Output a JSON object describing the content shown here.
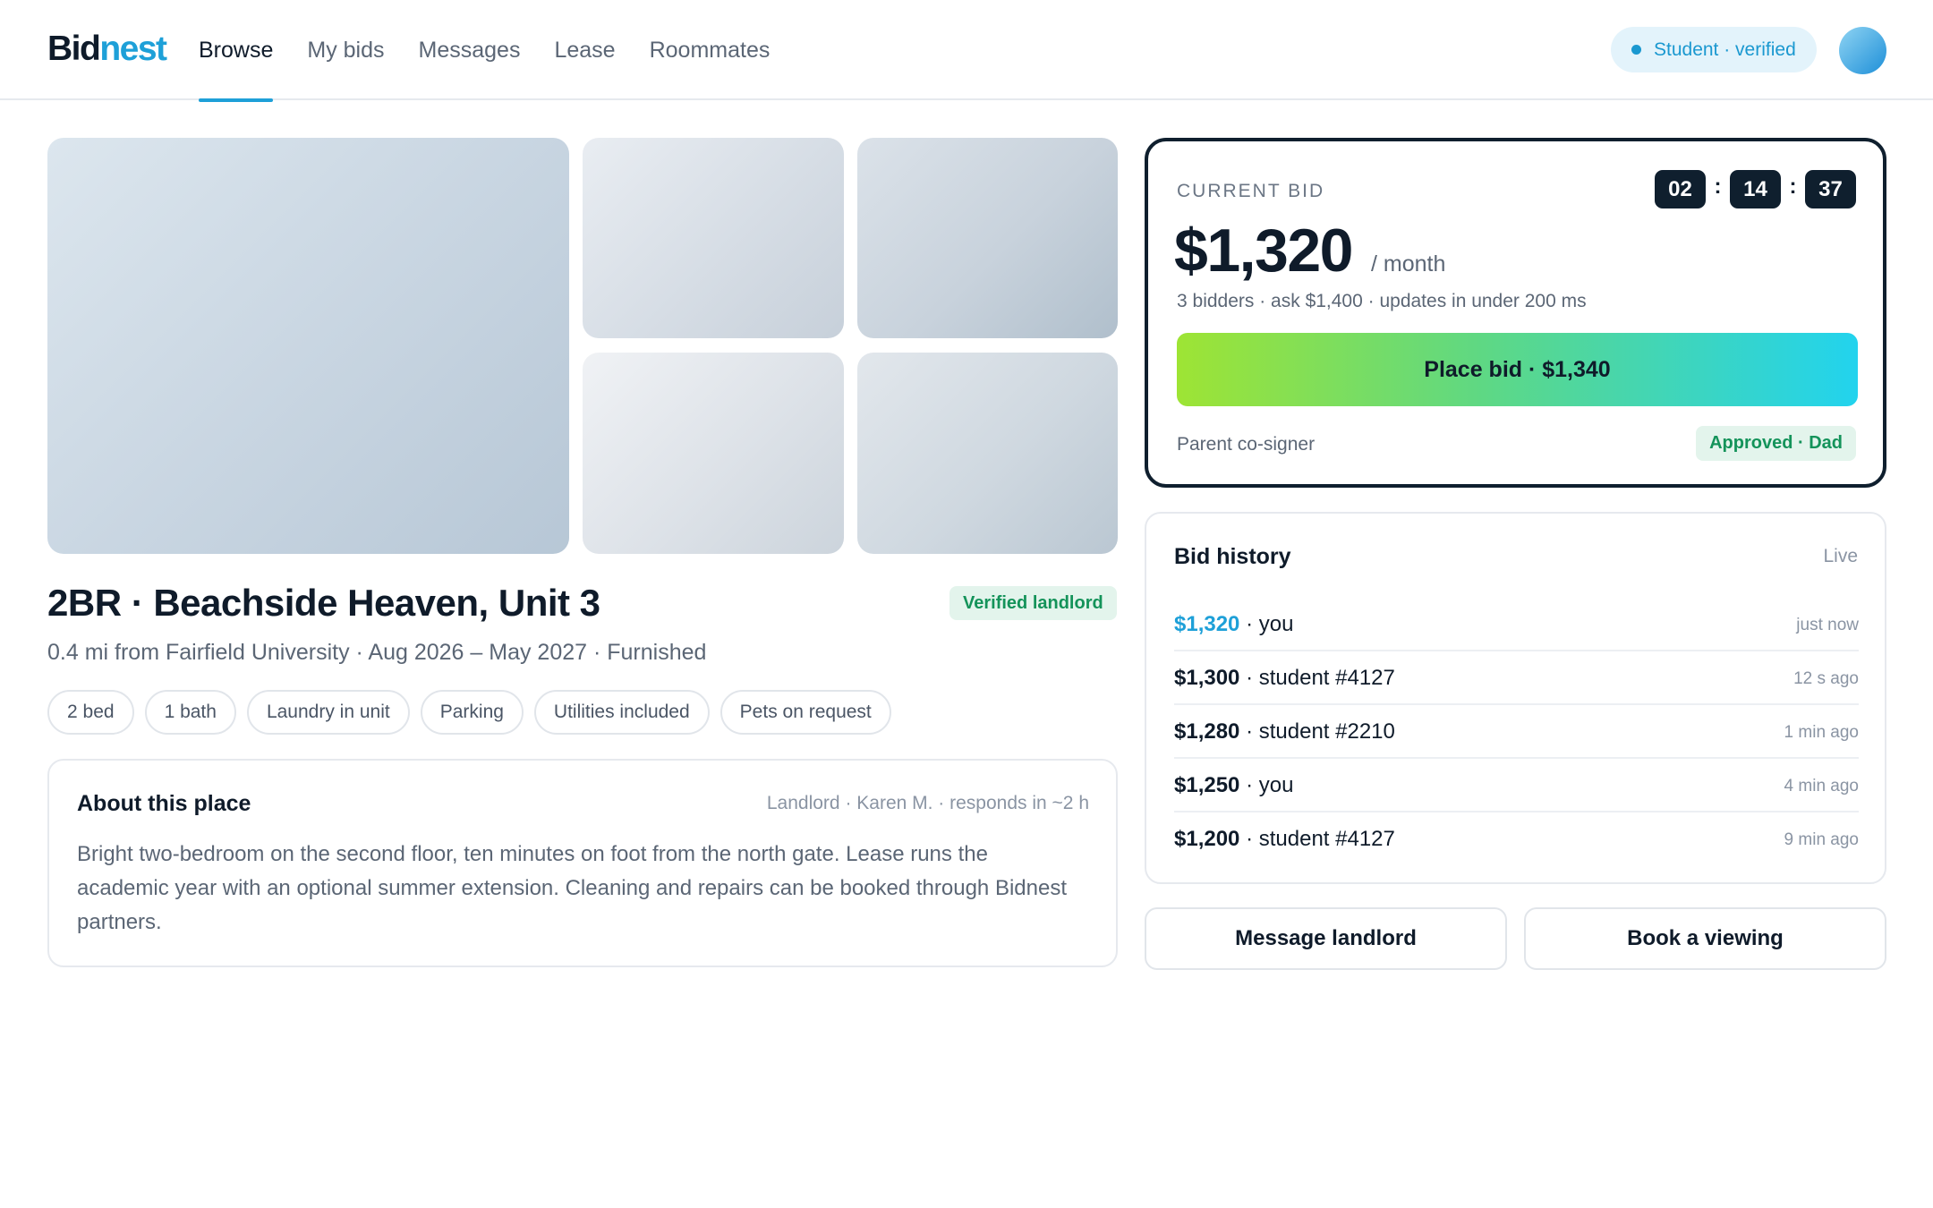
{
  "header": {
    "logo_part1": "Bid",
    "logo_part2": "nest",
    "nav": [
      {
        "label": "Browse",
        "active": true
      },
      {
        "label": "My bids"
      },
      {
        "label": "Messages"
      },
      {
        "label": "Lease"
      },
      {
        "label": "Roommates"
      }
    ],
    "status_pill": "Student · verified"
  },
  "listing": {
    "title": "2BR · Beachside Heaven, Unit 3",
    "badge": "Verified landlord",
    "subline": "0.4 mi from Fairfield University · Aug 2026 – May 2027 · Furnished",
    "chips": [
      "2 bed",
      "1 bath",
      "Laundry in unit",
      "Parking",
      "Utilities included",
      "Pets on request"
    ]
  },
  "about": {
    "heading": "About this place",
    "meta": "Landlord · Karen M. · responds in ~2 h",
    "body": "Bright two-bedroom on the second floor, ten minutes on foot from the north gate. Lease runs the academic year with an optional summer extension. Cleaning and repairs can be booked through Bidnest partners."
  },
  "bid": {
    "label": "CURRENT BID",
    "timer": {
      "h": "02",
      "m": "14",
      "s": "37",
      "sep": ":"
    },
    "amount": "$1,320",
    "per": "/ month",
    "meta": "3 bidders · ask $1,400 · updates in under 200 ms",
    "button": "Place bid · $1,340",
    "cosigner_label": "Parent co-signer",
    "cosigner_status": "Approved · Dad"
  },
  "history": {
    "heading": "Bid history",
    "live": "Live",
    "rows": [
      {
        "amount": "$1,320",
        "who": " · you",
        "when": "just now",
        "mine": true
      },
      {
        "amount": "$1,300",
        "who": " · student #4127",
        "when": "12 s ago"
      },
      {
        "amount": "$1,280",
        "who": " · student #2210",
        "when": "1 min ago"
      },
      {
        "amount": "$1,250",
        "who": " · you",
        "when": "4 min ago"
      },
      {
        "amount": "$1,200",
        "who": " · student #4127",
        "when": "9 min ago"
      }
    ]
  },
  "actions": {
    "message": "Message landlord",
    "viewing": "Book a viewing"
  },
  "colors": {
    "accent": "#1ea0d8",
    "ink": "#0f1b2a",
    "success": "#14935a",
    "bid_gradient_start": "#9ee434",
    "bid_gradient_end": "#22d3ee"
  }
}
